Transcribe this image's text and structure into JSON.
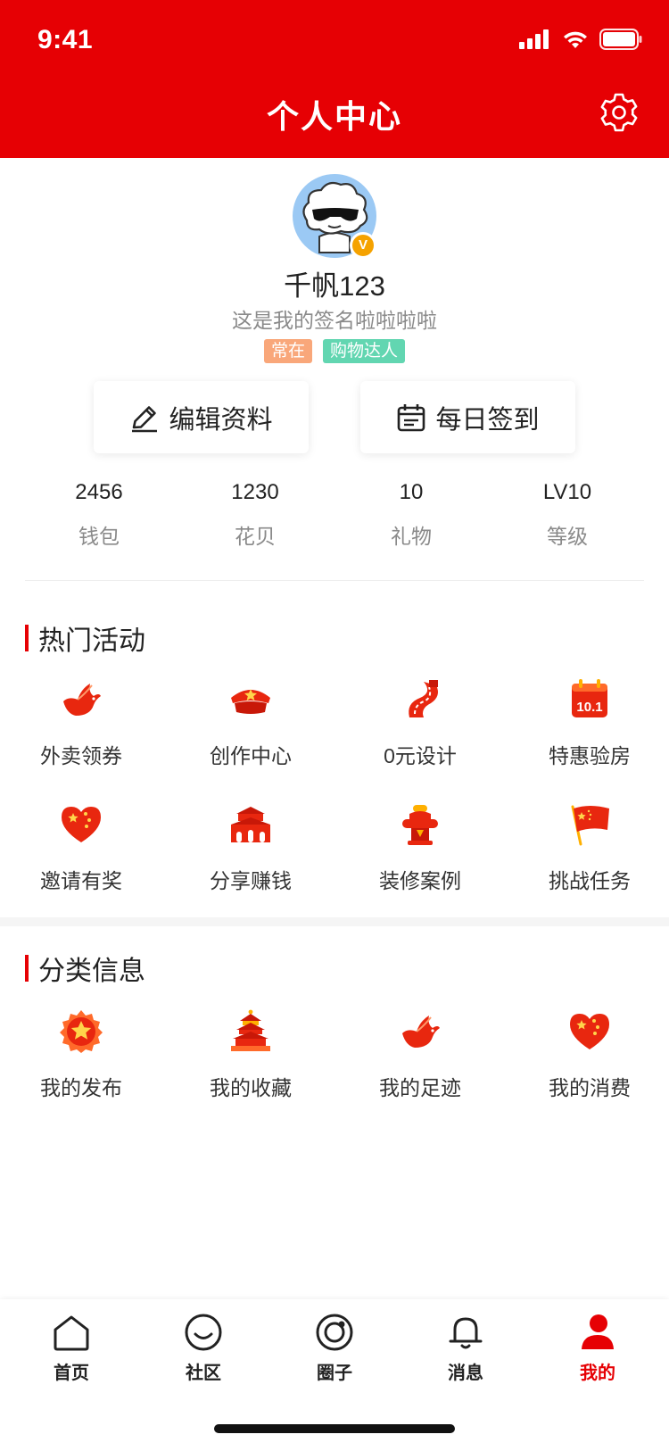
{
  "status_bar": {
    "time": "9:41"
  },
  "header": {
    "title": "个人中心"
  },
  "profile": {
    "username": "千帆123",
    "signature": "这是我的签名啦啦啦啦",
    "badge": "V",
    "tags": [
      "常在",
      "购物达人"
    ]
  },
  "actions": {
    "edit_label": "编辑资料",
    "checkin_label": "每日签到"
  },
  "stats": [
    {
      "value": "2456",
      "label": "钱包"
    },
    {
      "value": "1230",
      "label": "花贝"
    },
    {
      "value": "10",
      "label": "礼物"
    },
    {
      "value": "LV10",
      "label": "等级"
    }
  ],
  "hot_activities": {
    "title": "热门活动",
    "items": [
      {
        "label": "外卖领券",
        "icon": "dove-icon"
      },
      {
        "label": "创作中心",
        "icon": "cap-icon"
      },
      {
        "label": "0元设计",
        "icon": "road-icon"
      },
      {
        "label": "特惠验房",
        "icon": "calendar-icon"
      },
      {
        "label": "邀请有奖",
        "icon": "heart-star-icon"
      },
      {
        "label": "分享赚钱",
        "icon": "gate-icon"
      },
      {
        "label": "装修案例",
        "icon": "hydrant-icon"
      },
      {
        "label": "挑战任务",
        "icon": "flag-icon"
      }
    ]
  },
  "categories": {
    "title": "分类信息",
    "items": [
      {
        "label": "我的发布",
        "icon": "emblem-icon"
      },
      {
        "label": "我的收藏",
        "icon": "temple-icon"
      },
      {
        "label": "我的足迹",
        "icon": "dove-icon"
      },
      {
        "label": "我的消费",
        "icon": "heart-star-icon"
      }
    ]
  },
  "tabbar": {
    "items": [
      {
        "label": "首页",
        "icon": "home-icon"
      },
      {
        "label": "社区",
        "icon": "smile-icon"
      },
      {
        "label": "圈子",
        "icon": "circle-icon"
      },
      {
        "label": "消息",
        "icon": "bell-icon"
      },
      {
        "label": "我的",
        "icon": "user-icon"
      }
    ],
    "active_index": 4
  },
  "colors": {
    "brand": "#e60004",
    "tag_orange": "#f9a77a",
    "tag_green": "#62d6b1"
  }
}
